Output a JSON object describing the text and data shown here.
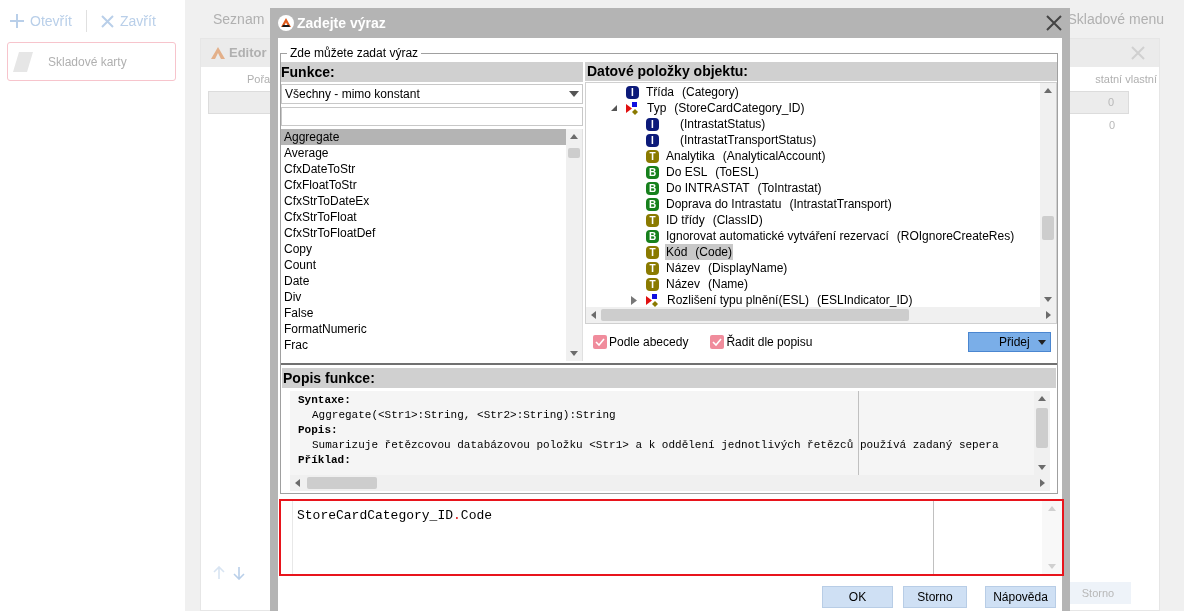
{
  "app": {
    "toolbar": [
      {
        "label": "Otevřít"
      },
      {
        "label": "Zavřít"
      }
    ],
    "nav_card": {
      "label": "Skladové karty"
    },
    "tabs": [
      "Seznam",
      "Skladové menu"
    ]
  },
  "editor_window": {
    "title": "Editor",
    "columns": [
      "Pořa",
      "statní vlastní"
    ],
    "rows": [
      {
        "value": "0",
        "selected": true
      },
      {
        "value": "0",
        "selected": false
      }
    ],
    "button": "Storno"
  },
  "dialog": {
    "title": "Zadejte výraz",
    "group_label": "Zde můžete zadat výraz",
    "functions": {
      "header": "Funkce:",
      "filter": {
        "value": "Všechny - mimo konstant"
      },
      "items": [
        {
          "label": "Aggregate",
          "selected": true
        },
        {
          "label": "Average",
          "selected": false
        },
        {
          "label": "CfxDateToStr",
          "selected": false
        },
        {
          "label": "CfxFloatToStr",
          "selected": false
        },
        {
          "label": "CfxStrToDateEx",
          "selected": false
        },
        {
          "label": "CfxStrToFloat",
          "selected": false
        },
        {
          "label": "CfxStrToFloatDef",
          "selected": false
        },
        {
          "label": "Copy",
          "selected": false
        },
        {
          "label": "Count",
          "selected": false
        },
        {
          "label": "Date",
          "selected": false
        },
        {
          "label": "Div",
          "selected": false
        },
        {
          "label": "False",
          "selected": false
        },
        {
          "label": "FormatNumeric",
          "selected": false
        },
        {
          "label": "Frac",
          "selected": false
        }
      ]
    },
    "fields": {
      "header": "Datové položky objektu:",
      "tree": [
        {
          "kind": "integer",
          "badge": "I",
          "label": "Třída",
          "field": "(Category)",
          "selected": false
        },
        {
          "kind": "object",
          "label": "Typ",
          "field": "(StoreCardCategory_ID)",
          "selected": false,
          "expanded": true,
          "children": [
            {
              "kind": "integer",
              "badge": "I",
              "field": "(IntrastatStatus)",
              "selected": false
            },
            {
              "kind": "integer",
              "badge": "I",
              "field": "(IntrastatTransportStatus)",
              "selected": false
            },
            {
              "kind": "text",
              "badge": "T",
              "label": "Analytika",
              "field": "(AnalyticalAccount)",
              "selected": false
            },
            {
              "kind": "boolean",
              "badge": "B",
              "label": "Do ESL",
              "field": "(ToESL)",
              "selected": false
            },
            {
              "kind": "boolean",
              "badge": "B",
              "label": "Do INTRASTAT",
              "field": "(ToIntrastat)",
              "selected": false
            },
            {
              "kind": "boolean",
              "badge": "B",
              "label": "Doprava do Intrastatu",
              "field": "(IntrastatTransport)",
              "selected": false
            },
            {
              "kind": "text",
              "badge": "T",
              "label": "ID třídy",
              "field": "(ClassID)",
              "selected": false
            },
            {
              "kind": "boolean",
              "badge": "B",
              "label": "Ignorovat automatické vytváření rezervací",
              "field": "(ROIgnoreCreateRes)",
              "selected": false
            },
            {
              "kind": "text",
              "badge": "T",
              "label": "Kód",
              "field": "(Code)",
              "selected": true
            },
            {
              "kind": "text",
              "badge": "T",
              "label": "Název",
              "field": "(DisplayName)",
              "selected": false
            },
            {
              "kind": "text",
              "badge": "T",
              "label": "Název",
              "field": "(Name)",
              "selected": false
            },
            {
              "kind": "object",
              "label": "Rozlišení typu plnění(ESL)",
              "field": "(ESLIndicator_ID)",
              "selected": false,
              "expanded": false
            }
          ]
        }
      ],
      "options": [
        {
          "label": "Podle abecedy",
          "checked": true
        },
        {
          "label": "Řadit dle popisu",
          "checked": true
        }
      ],
      "add_button": "Přidej"
    },
    "description": {
      "header": "Popis funkce:",
      "lines": [
        {
          "kind": "heading",
          "text": "Syntaxe:"
        },
        {
          "kind": "body",
          "text": "Aggregate(<Str1>:String, <Str2>:String):String"
        },
        {
          "kind": "heading",
          "text": "Popis:"
        },
        {
          "kind": "body",
          "text": "Sumarizuje řetězcovou databázovou položku <Str1> a k oddělení jednotlivých řetězců používá zadaný sepera"
        },
        {
          "kind": "heading",
          "text": "Příklad:"
        }
      ]
    },
    "expression": {
      "tokens": [
        {
          "kind": "identifier",
          "text": "StoreCardCategory_ID"
        },
        {
          "kind": "operator",
          "text": "."
        },
        {
          "kind": "identifier",
          "text": "Code"
        }
      ]
    },
    "buttons": [
      "OK",
      "Storno",
      "Nápověda"
    ]
  }
}
